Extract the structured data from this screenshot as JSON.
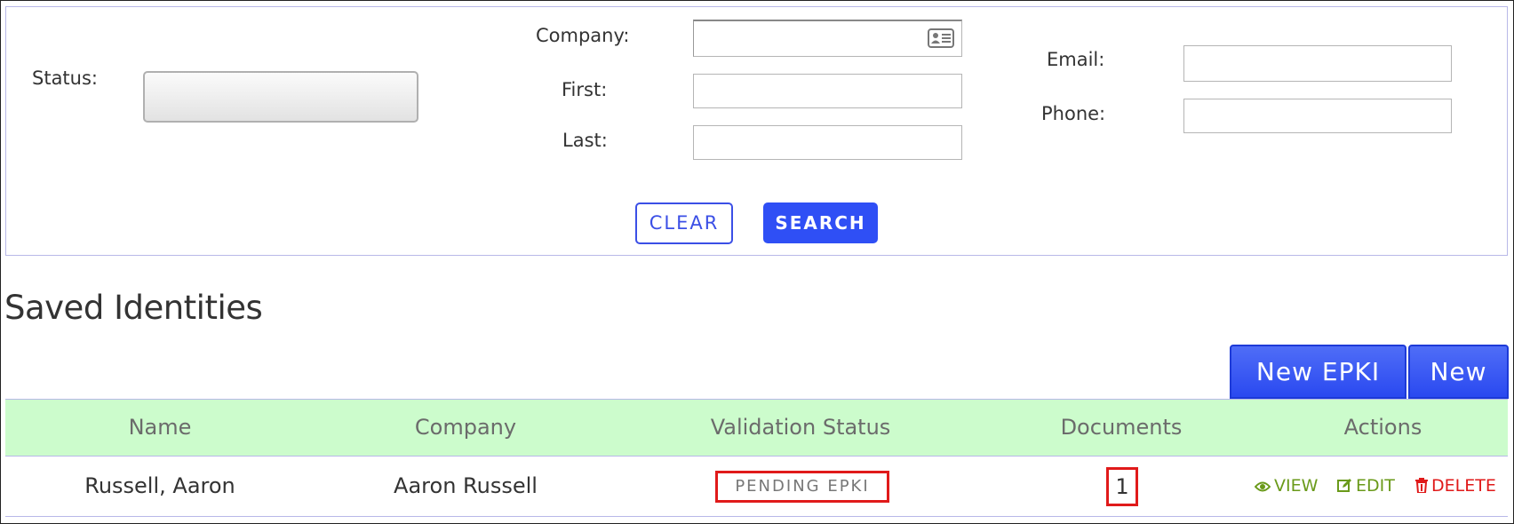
{
  "search": {
    "status_label": "Status:",
    "company_label": "Company:",
    "first_label": "First:",
    "last_label": "Last:",
    "email_label": "Email:",
    "phone_label": "Phone:",
    "clear_label": "CLEAR",
    "search_label": "SEARCH",
    "status_value": "",
    "company_value": "",
    "first_value": "",
    "last_value": "",
    "email_value": "",
    "phone_value": ""
  },
  "section": {
    "title": "Saved Identities",
    "new_epki_label": "New EPKI",
    "new_label": "New"
  },
  "table": {
    "headers": [
      "Name",
      "Company",
      "Validation Status",
      "Documents",
      "Actions"
    ],
    "rows": [
      {
        "name": "Russell, Aaron",
        "company": "Aaron Russell",
        "validation_status": "PENDING EPKI",
        "documents": "1",
        "actions": {
          "view": "VIEW",
          "edit": "EDIT",
          "delete": "DELETE"
        }
      }
    ]
  },
  "colors": {
    "accent": "#2f4ff5",
    "header_bg": "#ccfccc",
    "action_green": "#6a9a1a",
    "highlight_red": "#e01a1a"
  },
  "icons": {
    "company_field": "contact-card-icon",
    "view": "eye-icon",
    "edit": "edit-icon",
    "delete": "trash-icon"
  }
}
